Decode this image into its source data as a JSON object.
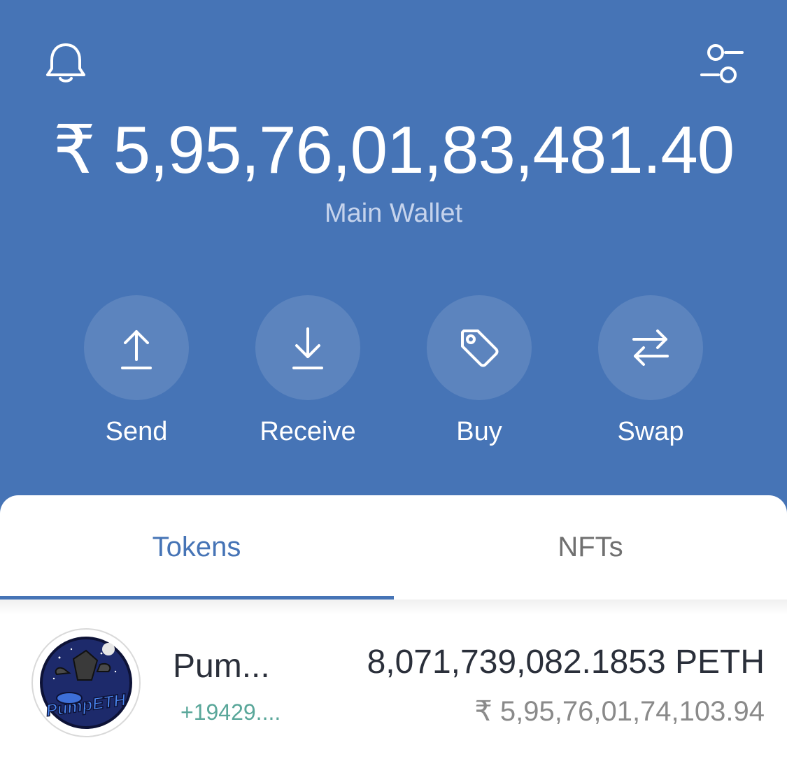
{
  "wallet": {
    "balance": "₹ 5,95,76,01,83,481.40",
    "name": "Main Wallet"
  },
  "header_icons": {
    "left": "bell-icon",
    "right": "settings-sliders-icon"
  },
  "actions": [
    {
      "label": "Send",
      "icon": "upload-arrow-icon"
    },
    {
      "label": "Receive",
      "icon": "download-arrow-icon"
    },
    {
      "label": "Buy",
      "icon": "tag-icon"
    },
    {
      "label": "Swap",
      "icon": "swap-arrows-icon"
    }
  ],
  "tabs": [
    {
      "label": "Tokens",
      "active": true
    },
    {
      "label": "NFTs",
      "active": false
    }
  ],
  "tokens": [
    {
      "name": "Pum...",
      "change": "+19429....",
      "amount": "8,071,739,082.1853 PETH",
      "value": "₹ 5,95,76,01,74,103.94",
      "logo_text": "PumpETH"
    }
  ],
  "colors": {
    "header_bg": "#4674b6",
    "accent": "#4674b6",
    "positive": "#5aa79a"
  }
}
